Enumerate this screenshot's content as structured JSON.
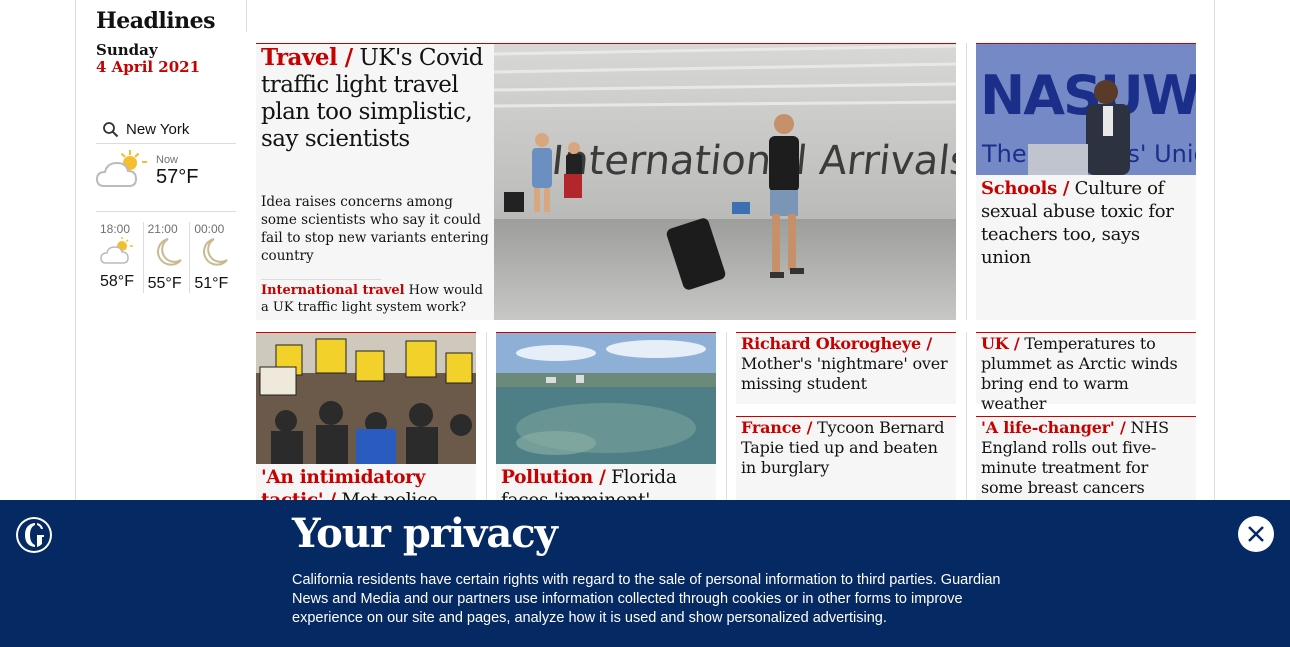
{
  "header": {
    "title": "Headlines",
    "day": "Sunday",
    "date": "4 April 2021"
  },
  "weather": {
    "city": "New York",
    "now_label": "Now",
    "now_temp": "57°F",
    "forecast": [
      {
        "time": "18:00",
        "temp": "58°F",
        "icon": "partly-cloudy-icon"
      },
      {
        "time": "21:00",
        "temp": "55°F",
        "icon": "moon-icon"
      },
      {
        "time": "00:00",
        "temp": "51°F",
        "icon": "moon-icon"
      }
    ]
  },
  "main_story": {
    "kicker": "Travel /",
    "headline": "UK's Covid traffic light travel plan too simplistic, say scientists",
    "standfirst": "Idea raises concerns among some scientists who say it could fail to stop new variants entering country",
    "sublink_kicker": "International travel",
    "sublink_text": "How would a UK traffic light system work?",
    "image_sign": "International Arrivals"
  },
  "schools_story": {
    "kicker": "Schools /",
    "headline": "Culture of sexual abuse toxic for teachers too, says union",
    "image_sign": "NASUWT",
    "image_sub": "The Teachers' Union"
  },
  "protest_story": {
    "kicker": "'An intimidatory tactic' /",
    "headline": "Met police"
  },
  "pollution_story": {
    "kicker": "Pollution /",
    "headline": "Florida faces 'imminent'"
  },
  "text_stories": [
    {
      "kicker": "Richard Okorogheye /",
      "headline": "Mother's 'nightmare' over missing student"
    },
    {
      "kicker": "UK /",
      "headline": "Temperatures to plummet as Arctic winds bring end to warm weather"
    },
    {
      "kicker": "France /",
      "headline": "Tycoon Bernard Tapie tied up and beaten in burglary"
    },
    {
      "kicker": "'A life-changer' /",
      "headline": "NHS England rolls out five-minute treatment for some breast cancers"
    }
  ],
  "privacy": {
    "title": "Your privacy",
    "body": "California residents have certain rights with regard to the sale of personal information to third parties. Guardian News and Media and our partners use information collected through cookies or in other forms to improve experience on our site and pages, analyze how it is used and show personalized advertising."
  },
  "colors": {
    "accent": "#c70000",
    "brand_blue": "#052962",
    "card_bg": "#f6f6f6"
  }
}
